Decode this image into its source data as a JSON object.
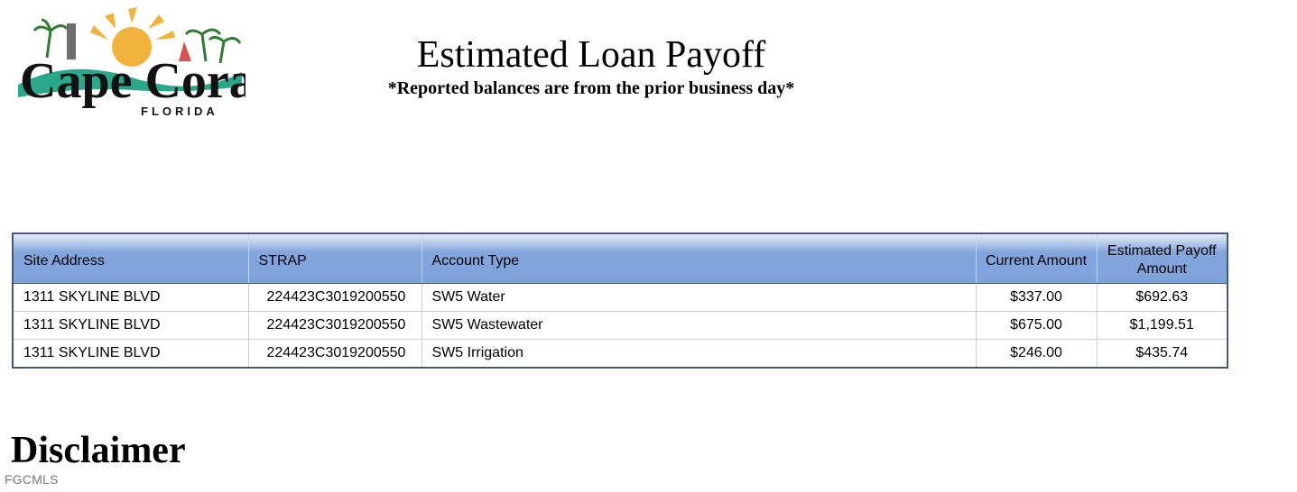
{
  "header": {
    "logo_main": "Cape Coral",
    "logo_sub": "FLORIDA",
    "title": "Estimated Loan Payoff",
    "subtitle": "*Reported balances are from the prior business day*"
  },
  "table": {
    "columns": [
      "Site Address",
      "STRAP",
      "Account Type",
      "Current Amount",
      "Estimated Payoff Amount"
    ],
    "rows": [
      [
        "1311 SKYLINE BLVD",
        "224423C3019200550",
        "SW5 Water",
        "$337.00",
        "$692.63"
      ],
      [
        "1311 SKYLINE BLVD",
        "224423C3019200550",
        "SW5 Wastewater",
        "$675.00",
        "$1,199.51"
      ],
      [
        "1311 SKYLINE BLVD",
        "224423C3019200550",
        "SW5 Irrigation",
        "$246.00",
        "$435.74"
      ]
    ]
  },
  "footer": {
    "disclaimer_heading": "Disclaimer",
    "watermark": "FGCMLS"
  },
  "colors": {
    "header_blue": "#7ea2da",
    "table_border": "#43597d",
    "sun": "#f2b33d",
    "wave": "#29a88a"
  }
}
